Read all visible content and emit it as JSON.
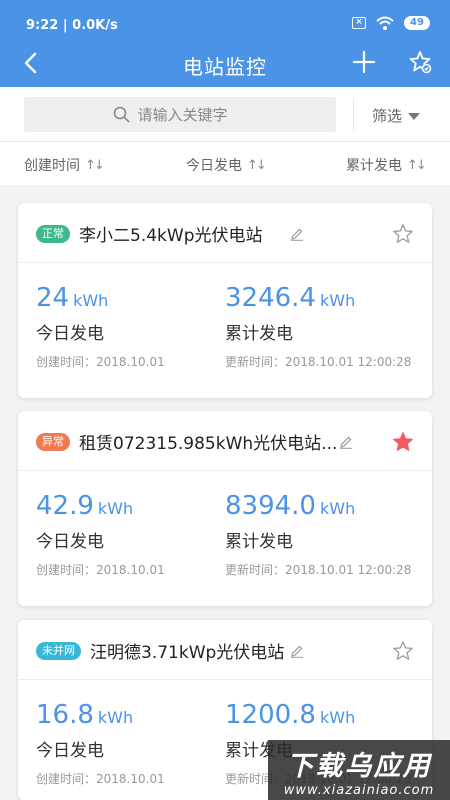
{
  "status_bar": {
    "time": "9:22",
    "network_speed": "0.0K/s",
    "sim_icon": "sim-off-icon",
    "wifi_icon": "wifi-icon",
    "battery": "49"
  },
  "nav": {
    "title": "电站监控",
    "back_icon": "chevron-left-icon",
    "add_icon": "plus-icon",
    "fav_icon": "star-settings-icon"
  },
  "search": {
    "placeholder": "请输入关键字",
    "value": ""
  },
  "filter": {
    "label": "筛选"
  },
  "sort": [
    {
      "label": "创建时间"
    },
    {
      "label": "今日发电"
    },
    {
      "label": "累计发电"
    }
  ],
  "colors": {
    "primary": "#4a93e6",
    "tag_normal": "#3dba8a",
    "tag_abnormal": "#f07a52",
    "tag_offgrid": "#38b8d8",
    "star_active": "#f25a62"
  },
  "stations": [
    {
      "status": "正常",
      "name": "李小二5.4kWp光伏电站",
      "favorite": false,
      "today_value": "24",
      "today_unit": "kWh",
      "today_label": "今日发电",
      "total_value": "3246.4",
      "total_unit": "kWh",
      "total_label": "累计发电",
      "created": "创建时间：2018.10.01",
      "updated": "更新时间：2018.10.01 12:00:28"
    },
    {
      "status": "异常",
      "name": "租赁072315.985kWh光伏电站...",
      "favorite": true,
      "today_value": "42.9",
      "today_unit": "kWh",
      "today_label": "今日发电",
      "total_value": "8394.0",
      "total_unit": "kWh",
      "total_label": "累计发电",
      "created": "创建时间：2018.10.01",
      "updated": "更新时间：2018.10.01 12:00:28"
    },
    {
      "status": "未并网",
      "name": "汪明德3.71kWp光伏电站",
      "favorite": false,
      "today_value": "16.8",
      "today_unit": "kWh",
      "today_label": "今日发电",
      "total_value": "1200.8",
      "total_unit": "kWh",
      "total_label": "累计发电",
      "created": "创建时间：2018.10.01",
      "updated": "更新时间：2018.10.01 12:00:28"
    }
  ],
  "watermark": {
    "title": "下载乌应用",
    "url": "www.xiazainiao.com"
  }
}
